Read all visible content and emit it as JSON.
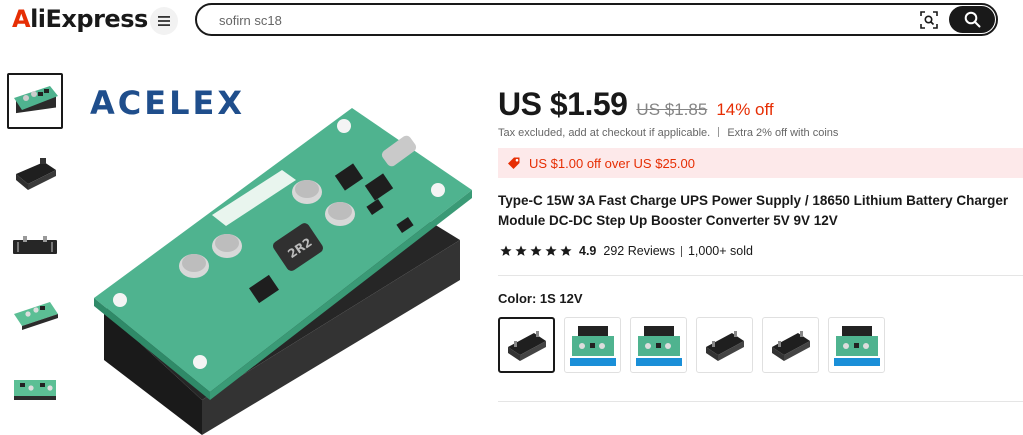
{
  "header": {
    "logo": {
      "first": "A",
      "rest": "liExpress"
    },
    "search": {
      "value": "sofirn sc18"
    },
    "icons": [
      "menu-icon",
      "camera-search-icon",
      "search-icon"
    ]
  },
  "gallery": {
    "thumbnails": [
      {
        "icon": "pcb-board-image",
        "selected": true
      },
      {
        "icon": "battery-holder-image",
        "selected": false
      },
      {
        "icon": "battery-holder-image",
        "selected": false
      },
      {
        "icon": "pcb-board-image",
        "selected": false
      },
      {
        "icon": "pcb-board-image",
        "selected": false
      }
    ],
    "main_image": {
      "brand_text": "ACELEX",
      "chip_label": "2R2"
    }
  },
  "product": {
    "price": "US $1.59",
    "original_price": "US $1.85",
    "discount": "14% off",
    "tax_note": "Tax excluded, add at checkout if applicable.",
    "coins_note": "Extra 2% off with coins",
    "coupon_text": "US $1.00 off over US $25.00",
    "title": "Type-C 15W 3A Fast Charge UPS Power Supply / 18650 Lithium Battery Charger Module DC-DC Step Up Booster Converter 5V 9V 12V",
    "rating": {
      "stars": 5,
      "score": "4.9",
      "reviews": "292 Reviews",
      "sold": "1,000+ sold"
    },
    "color": {
      "label": "Color:",
      "selected": "1S 12V",
      "options": [
        "battery-holder",
        "pcb-board",
        "pcb-board",
        "battery-holder",
        "battery-holder",
        "pcb-board"
      ]
    }
  },
  "colors": {
    "accent": "#e62e04",
    "coupon_bg": "#fde9ea",
    "pcb_green": "#4fb38f",
    "text": "#191919"
  }
}
